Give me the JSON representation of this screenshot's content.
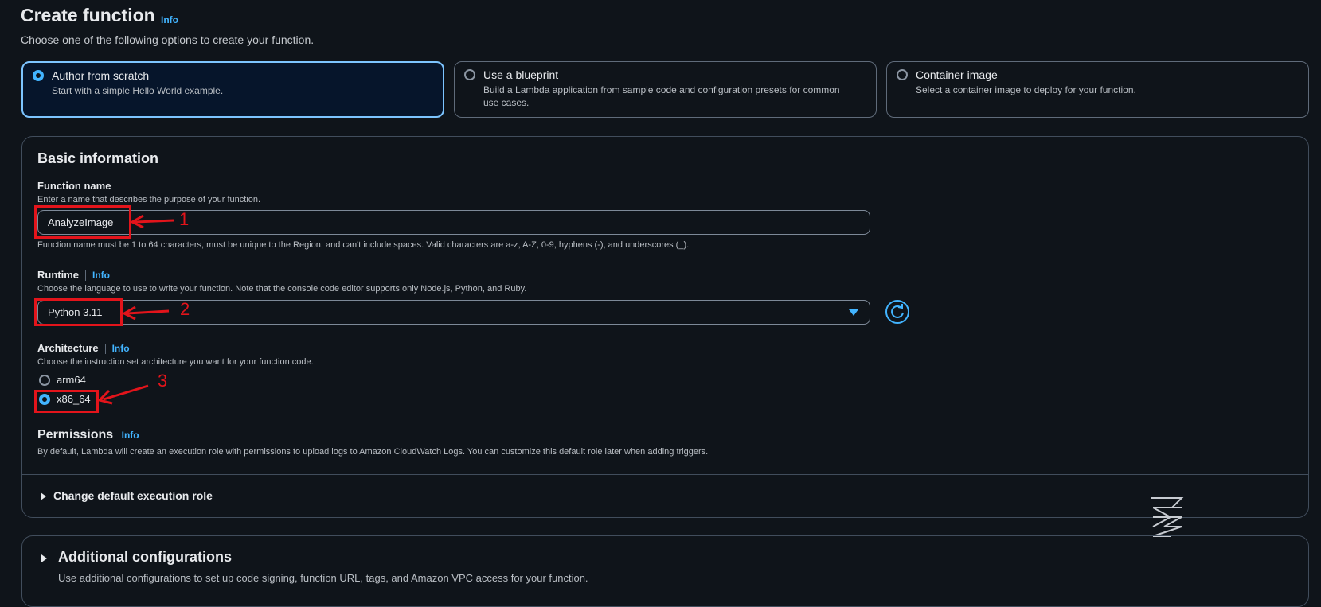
{
  "header": {
    "title": "Create function",
    "info": "Info",
    "subtitle": "Choose one of the following options to create your function."
  },
  "options": [
    {
      "title": "Author from scratch",
      "desc": "Start with a simple Hello World example.",
      "selected": true
    },
    {
      "title": "Use a blueprint",
      "desc": "Build a Lambda application from sample code and configuration presets for common use cases.",
      "selected": false
    },
    {
      "title": "Container image",
      "desc": "Select a container image to deploy for your function.",
      "selected": false
    }
  ],
  "basic": {
    "title": "Basic information",
    "function_name": {
      "label": "Function name",
      "hint": "Enter a name that describes the purpose of your function.",
      "value": "AnalyzeImage",
      "constraint": "Function name must be 1 to 64 characters, must be unique to the Region, and can't include spaces. Valid characters are a-z, A-Z, 0-9, hyphens (-), and underscores (_)."
    },
    "runtime": {
      "label": "Runtime",
      "info": "Info",
      "hint": "Choose the language to use to write your function. Note that the console code editor supports only Node.js, Python, and Ruby.",
      "value": "Python 3.11"
    },
    "architecture": {
      "label": "Architecture",
      "info": "Info",
      "hint": "Choose the instruction set architecture you want for your function code.",
      "options": [
        {
          "label": "arm64",
          "selected": false
        },
        {
          "label": "x86_64",
          "selected": true
        }
      ]
    },
    "permissions": {
      "title": "Permissions",
      "info": "Info",
      "desc": "By default, Lambda will create an execution role with permissions to upload logs to Amazon CloudWatch Logs. You can customize this default role later when adding triggers."
    },
    "change_role": "Change default execution role"
  },
  "additional": {
    "title": "Additional configurations",
    "desc": "Use additional configurations to set up code signing, function URL, tags, and Amazon VPC access for your function."
  },
  "annotations": [
    "1",
    "2",
    "3"
  ],
  "colors": {
    "accent": "#42b4ff",
    "annotation": "#e3141b",
    "background": "#0f141a"
  }
}
